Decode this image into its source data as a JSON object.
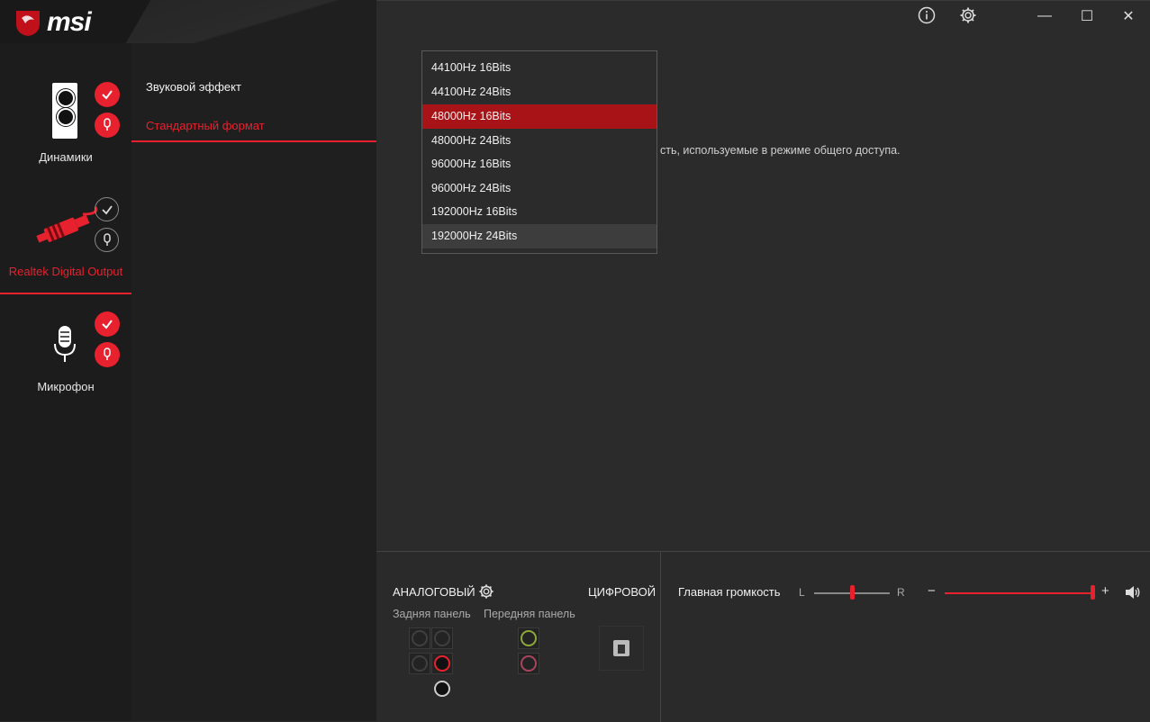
{
  "brand": {
    "name": "msi",
    "accent": "#e8212e"
  },
  "window": {
    "info_icon": "info-icon",
    "settings_icon": "gear-icon",
    "minimize": "—",
    "maximize": "☐",
    "close": "✕"
  },
  "devices": [
    {
      "label": "Динамики",
      "icon": "speaker-icon",
      "active": false
    },
    {
      "label": "Realtek Digital Output",
      "icon": "digital-cable-icon",
      "active": true
    },
    {
      "label": "Микрофон",
      "icon": "microphone-icon",
      "active": false
    }
  ],
  "nav": {
    "items": [
      {
        "label": "Звуковой эффект",
        "active": false
      },
      {
        "label": "Стандартный формат",
        "active": true
      }
    ]
  },
  "format": {
    "options": [
      "44100Hz 16Bits",
      "44100Hz 24Bits",
      "48000Hz 16Bits",
      "48000Hz 24Bits",
      "96000Hz 16Bits",
      "96000Hz 24Bits",
      "192000Hz 16Bits",
      "192000Hz 24Bits"
    ],
    "selected": "48000Hz 16Bits",
    "hovered": "192000Hz 24Bits",
    "description": "сть, используемые в режиме общего доступа."
  },
  "connectors": {
    "analog_label": "АНАЛОГОВЫЙ",
    "digital_label": "ЦИФРОВОЙ",
    "rear_panel": "Задняя панель",
    "front_panel": "Передняя панель"
  },
  "volume": {
    "label": "Главная громкость",
    "left": "L",
    "right": "R",
    "minus": "−",
    "plus": "+",
    "balance": 0.5,
    "level": 1.0
  }
}
